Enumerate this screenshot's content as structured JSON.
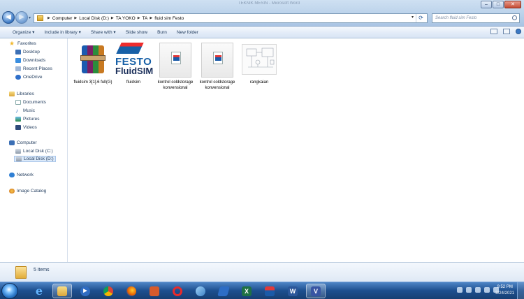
{
  "window": {
    "title_faint": "TEKNIK MESIN - Microsoft Word"
  },
  "address": {
    "crumbs": [
      "Computer",
      "Local Disk (D:)",
      "TA YOKO",
      "TA",
      "fluid sim Festo"
    ],
    "search_placeholder": "Search fluid sim Festo"
  },
  "toolbar": {
    "organize": "Organize ▾",
    "include": "Include in library ▾",
    "share": "Share with ▾",
    "slideshow": "Slide show",
    "burn": "Burn",
    "new_folder": "New folder"
  },
  "nav": {
    "favorites": "Favorites",
    "desktop": "Desktop",
    "downloads": "Downloads",
    "recent": "Recent Places",
    "onedrive": "OneDrive",
    "libraries": "Libraries",
    "documents": "Documents",
    "music": "Music",
    "pictures": "Pictures",
    "videos": "Videos",
    "computer": "Computer",
    "disk_c": "Local Disk (C:)",
    "disk_d": "Local Disk (D:)",
    "network": "Network",
    "image_catalog": "Image Catalog"
  },
  "files": [
    {
      "name": "fluidsim 3[1].6 full(G)",
      "kind": "winrar-archive"
    },
    {
      "name": "fluidsim",
      "kind": "festo-fluidsim-app",
      "logo_line1": "FESTO",
      "logo_line2": "FluidSIM"
    },
    {
      "name": "kontrol coldstorage konvensional",
      "kind": "fluidsim-document"
    },
    {
      "name": "kontrol coldstorage konvensional",
      "kind": "fluidsim-document"
    },
    {
      "name": "rangkaian",
      "kind": "circuit-image"
    }
  ],
  "details": {
    "count": "5 items"
  },
  "clock": {
    "time": "9:52 PM",
    "date": "8/24/2021"
  },
  "taskbar_apps": [
    "internet-explorer",
    "file-explorer",
    "media-player",
    "chrome",
    "firefox",
    "presentation",
    "opera",
    "paint",
    "notes",
    "excel",
    "fluidsim",
    "word-doc",
    "visio"
  ]
}
